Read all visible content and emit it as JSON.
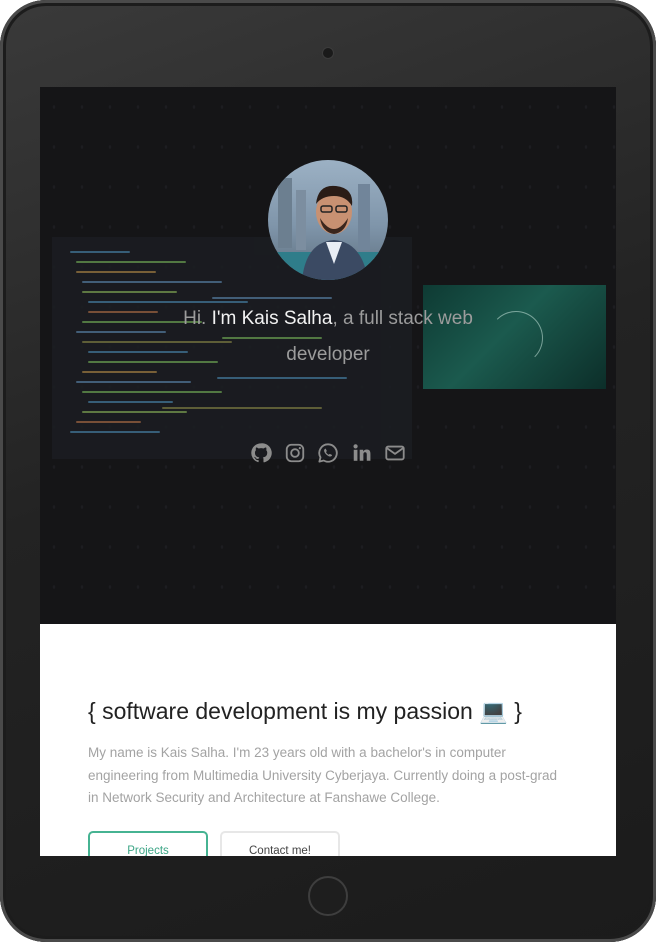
{
  "hero": {
    "greeting_prefix": "Hi. ",
    "name": "I'm Kais Salha",
    "greeting_suffix": ", a full stack web developer",
    "avatar_alt": "Kais Salha"
  },
  "social_links": [
    {
      "icon": "github-icon",
      "label": "GitHub"
    },
    {
      "icon": "instagram-icon",
      "label": "Instagram"
    },
    {
      "icon": "whatsapp-icon",
      "label": "WhatsApp"
    },
    {
      "icon": "linkedin-icon",
      "label": "LinkedIn"
    },
    {
      "icon": "envelope-icon",
      "label": "Email"
    }
  ],
  "about": {
    "headline": "{ software development is my passion 💻 }",
    "bio": "My name is Kais Salha. I'm 23 years old with a bachelor's in computer engineering from Multimedia University Cyberjaya. Currently doing a post-grad in Network Security and Architecture at Fanshawe College."
  },
  "buttons": {
    "projects_label": "Projects",
    "contact_label": "Contact me!"
  },
  "colors": {
    "hero_background": "#151517",
    "accent_green": "#46b392",
    "headline_text": "#222222",
    "muted_text": "#a3a3a3"
  }
}
